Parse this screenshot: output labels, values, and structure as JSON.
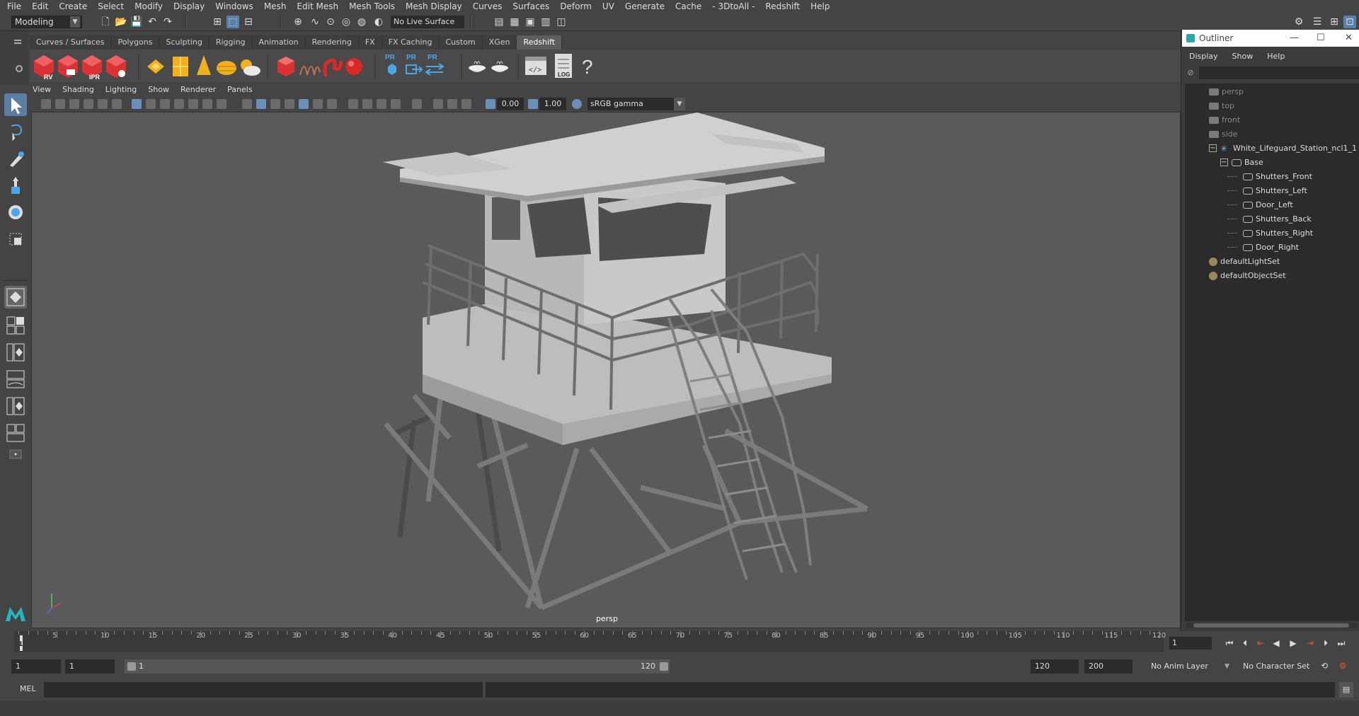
{
  "menubar": {
    "items": [
      "File",
      "Edit",
      "Create",
      "Select",
      "Modify",
      "Display",
      "Windows",
      "Mesh",
      "Edit Mesh",
      "Mesh Tools",
      "Mesh Display",
      "Curves",
      "Surfaces",
      "Deform",
      "UV",
      "Generate",
      "Cache",
      "- 3DtoAll -",
      "Redshift",
      "Help"
    ]
  },
  "statusline": {
    "mode": "Modeling",
    "live_surface": "No Live Surface"
  },
  "shelf": {
    "tabs": [
      "Curves / Surfaces",
      "Polygons",
      "Sculpting",
      "Rigging",
      "Animation",
      "Rendering",
      "FX",
      "FX Caching",
      "Custom",
      "XGen",
      "Redshift"
    ],
    "active_tab": "Redshift",
    "icon_labels": [
      "RV",
      "IPR",
      "PR",
      "PR",
      "PR",
      "LOG"
    ]
  },
  "viewport": {
    "menu": [
      "View",
      "Shading",
      "Lighting",
      "Show",
      "Renderer",
      "Panels"
    ],
    "exposure": "0.00",
    "gamma": "1.00",
    "color_management": "sRGB gamma",
    "camera_label": "persp"
  },
  "outliner": {
    "title": "Outliner",
    "menu": [
      "Display",
      "Show",
      "Help"
    ],
    "items": [
      {
        "label": "persp",
        "type": "camera",
        "dim": true
      },
      {
        "label": "top",
        "type": "camera",
        "dim": true
      },
      {
        "label": "front",
        "type": "camera",
        "dim": true
      },
      {
        "label": "side",
        "type": "camera",
        "dim": true
      },
      {
        "label": "White_Lifeguard_Station_ncl1_1",
        "type": "group",
        "dim": false
      },
      {
        "label": "Base",
        "type": "mesh",
        "dim": false
      },
      {
        "label": "Shutters_Front",
        "type": "mesh",
        "dim": false
      },
      {
        "label": "Shutters_Left",
        "type": "mesh",
        "dim": false
      },
      {
        "label": "Door_Left",
        "type": "mesh",
        "dim": false
      },
      {
        "label": "Shutters_Back",
        "type": "mesh",
        "dim": false
      },
      {
        "label": "Shutters_Right",
        "type": "mesh",
        "dim": false
      },
      {
        "label": "Door_Right",
        "type": "mesh",
        "dim": false
      },
      {
        "label": "defaultLightSet",
        "type": "set",
        "dim": false
      },
      {
        "label": "defaultObjectSet",
        "type": "set",
        "dim": false
      }
    ]
  },
  "timeline": {
    "ticks": [
      "5",
      "10",
      "15",
      "20",
      "25",
      "30",
      "35",
      "40",
      "45",
      "50",
      "55",
      "60",
      "65",
      "70",
      "75",
      "80",
      "85",
      "90",
      "95",
      "100",
      "105",
      "110",
      "115",
      "120"
    ],
    "current_frame": "1",
    "marker_label": "1"
  },
  "range": {
    "start": "1",
    "playback_start": "1",
    "slider_start": "1",
    "slider_end": "120",
    "playback_end": "120",
    "end": "200",
    "anim_layer": "No Anim Layer",
    "character_set": "No Character Set"
  },
  "cmdline": {
    "mode": "MEL"
  }
}
